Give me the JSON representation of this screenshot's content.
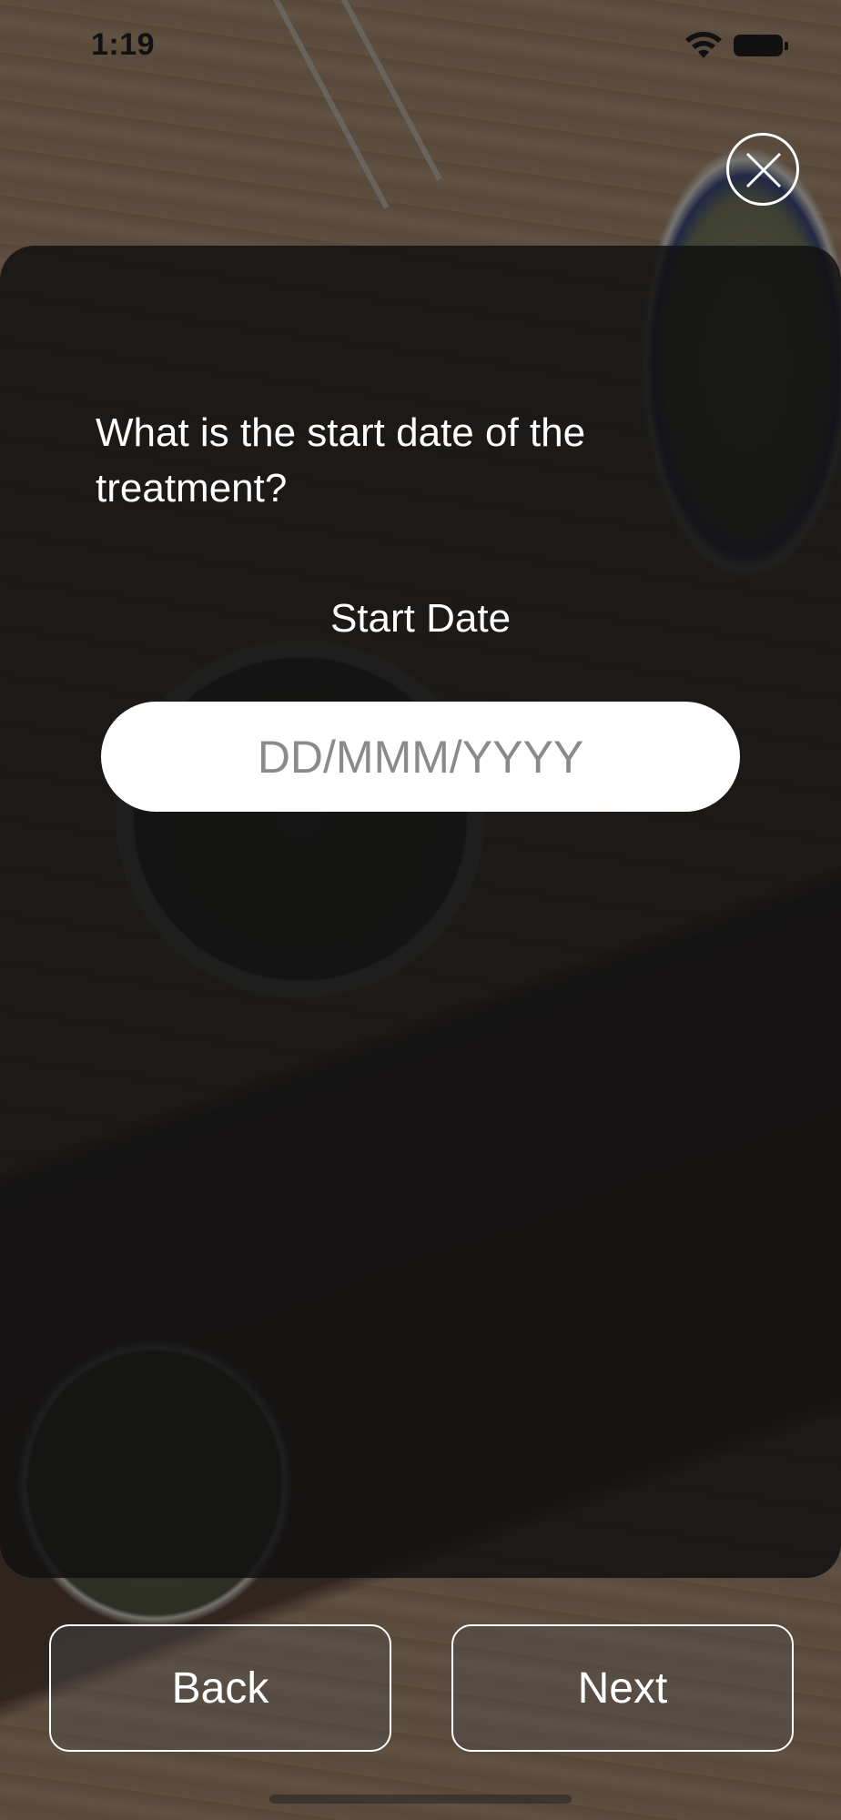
{
  "status_bar": {
    "time": "1:19",
    "wifi_icon": "wifi-icon",
    "battery_icon": "battery-icon"
  },
  "close_button": {
    "icon": "close-icon"
  },
  "form": {
    "question": "What is the start date of the treatment?",
    "field_label": "Start Date",
    "date_placeholder": "DD/MMM/YYYY",
    "date_value": ""
  },
  "navigation": {
    "back_label": "Back",
    "next_label": "Next"
  },
  "colors": {
    "card_background": "#121212",
    "text": "#ffffff",
    "input_background": "#ffffff",
    "placeholder": "#8a8a8a"
  }
}
